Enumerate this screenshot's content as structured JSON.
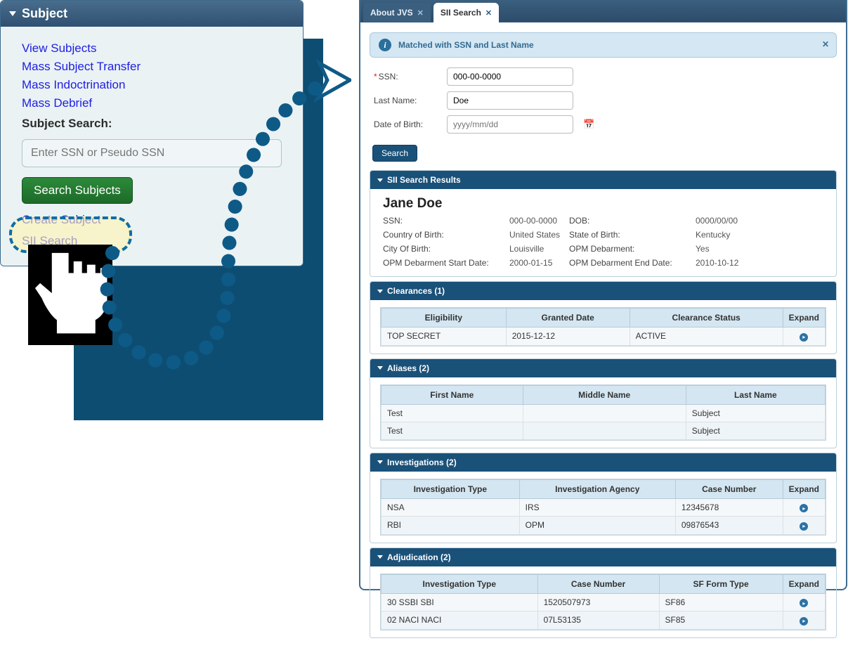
{
  "leftPanel": {
    "title": "Subject",
    "links": {
      "view": "View Subjects",
      "transfer": "Mass Subject Transfer",
      "indoctrination": "Mass Indoctrination",
      "debrief": "Mass Debrief"
    },
    "searchLabel": "Subject Search:",
    "ssnPlaceholder": "Enter SSN or Pseudo SSN",
    "searchButton": "Search Subjects",
    "createLink": "Create Subject",
    "siiLink": "SII Search"
  },
  "tabs": {
    "about": "About JVS",
    "sii": "SII Search"
  },
  "infoBar": "Matched with SSN and Last Name",
  "form": {
    "ssnLabel": "SSN:",
    "ssnValue": "000-00-0000",
    "lastNameLabel": "Last Name:",
    "lastNameValue": "Doe",
    "dobLabel": "Date of Birth:",
    "dobPlaceholder": "yyyy/mm/dd",
    "searchButton": "Search"
  },
  "results": {
    "headerTitle": "SII Search Results",
    "name": "Jane Doe",
    "fields": {
      "ssnLabel": "SSN:",
      "ssnVal": "000-00-0000",
      "dobLabel": "DOB:",
      "dobVal": "0000/00/00",
      "cobLabel": "Country of Birth:",
      "cobVal": "United States",
      "sobLabel": "State of Birth:",
      "sobVal": "Kentucky",
      "cityLabel": "City Of Birth:",
      "cityVal": "Louisville",
      "opmDebLabel": "OPM Debarment:",
      "opmDebVal": "Yes",
      "opmStartLabel": "OPM Debarment Start Date:",
      "opmStartVal": "2000-01-15",
      "opmEndLabel": "OPM Debarment End Date:",
      "opmEndVal": "2010-10-12"
    }
  },
  "clearances": {
    "title": "Clearances (1)",
    "headers": {
      "eligibility": "Eligibility",
      "granted": "Granted Date",
      "status": "Clearance Status",
      "expand": "Expand"
    },
    "rows": [
      {
        "eligibility": "TOP SECRET",
        "granted": "2015-12-12",
        "status": "ACTIVE"
      }
    ]
  },
  "aliases": {
    "title": "Aliases (2)",
    "headers": {
      "first": "First Name",
      "middle": "Middle Name",
      "last": "Last Name"
    },
    "rows": [
      {
        "first": "Test",
        "middle": "",
        "last": "Subject"
      },
      {
        "first": "Test",
        "middle": "",
        "last": "Subject"
      }
    ]
  },
  "investigations": {
    "title": "Investigations (2)",
    "headers": {
      "type": "Investigation Type",
      "agency": "Investigation Agency",
      "case": "Case Number",
      "expand": "Expand"
    },
    "rows": [
      {
        "type": "NSA",
        "agency": "IRS",
        "case": "12345678"
      },
      {
        "type": "RBI",
        "agency": "OPM",
        "case": "09876543"
      }
    ]
  },
  "adjudication": {
    "title": "Adjudication (2)",
    "headers": {
      "type": "Investigation Type",
      "case": "Case Number",
      "sf": "SF Form Type",
      "expand": "Expand"
    },
    "rows": [
      {
        "type": "30 SSBI SBI",
        "case": "1520507973",
        "sf": "SF86"
      },
      {
        "type": "02 NACI NACI",
        "case": "07L53135",
        "sf": "SF85"
      }
    ]
  }
}
